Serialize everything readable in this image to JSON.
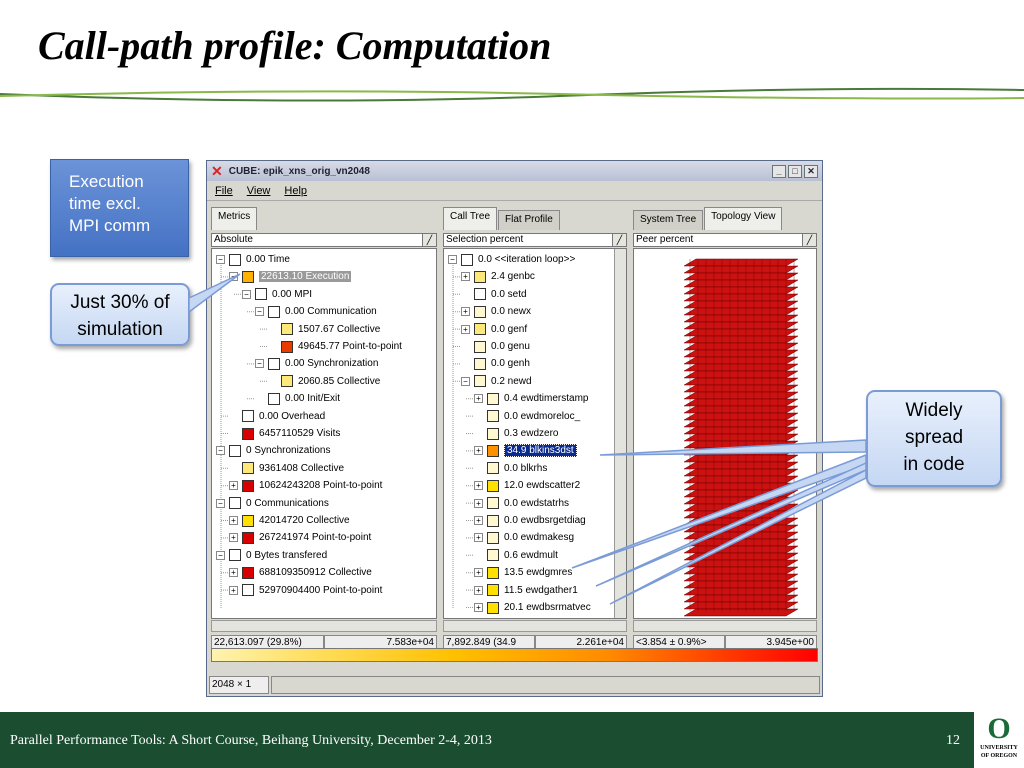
{
  "slide": {
    "title": "Call-path profile: Computation",
    "footer": "Parallel Performance Tools: A Short Course, Beihang University, December 2-4, 2013",
    "page": "12",
    "logo_line1": "UNIVERSITY",
    "logo_line2": "OF OREGON",
    "logo_letter": "O"
  },
  "callouts": {
    "exec": [
      "Execution",
      "time excl.",
      "MPI comm"
    ],
    "just": [
      "Just 30% of",
      "simulation"
    ],
    "widely": [
      "Widely",
      "spread",
      "in code"
    ]
  },
  "window": {
    "title": "CUBE: epik_xns_orig_vn2048",
    "menu": [
      "File",
      "View",
      "Help"
    ],
    "min": "_",
    "max": "□",
    "close": "✕"
  },
  "metrics": {
    "tab": "Metrics",
    "combo": "Absolute",
    "status_left": "22,613.097  (29.8%)",
    "status_right": "7.583e+04",
    "rows": [
      {
        "text": "0.00 Time",
        "color": "#ffffff",
        "exp": "−"
      },
      {
        "text": "22613.10 Execution",
        "color": "#ffb000",
        "exp": "−",
        "sel": true
      },
      {
        "text": "0.00 MPI",
        "color": "#ffffff",
        "exp": "−"
      },
      {
        "text": "0.00 Communication",
        "color": "#ffffff",
        "exp": "−"
      },
      {
        "text": "1507.67 Collective",
        "color": "#ffe87a",
        "exp": ""
      },
      {
        "text": "49645.77 Point-to-point",
        "color": "#e83c00",
        "exp": ""
      },
      {
        "text": "0.00 Synchronization",
        "color": "#ffffff",
        "exp": "−"
      },
      {
        "text": "2060.85 Collective",
        "color": "#ffe87a",
        "exp": ""
      },
      {
        "text": "0.00 Init/Exit",
        "color": "#ffffff",
        "exp": ""
      },
      {
        "text": "0.00 Overhead",
        "color": "#ffffff",
        "exp": ""
      },
      {
        "text": "6457110529 Visits",
        "color": "#d80000",
        "exp": ""
      },
      {
        "text": "0 Synchronizations",
        "color": "#ffffff",
        "exp": "−"
      },
      {
        "text": "9361408 Collective",
        "color": "#ffe87a",
        "exp": ""
      },
      {
        "text": "10624243208 Point-to-point",
        "color": "#d80000",
        "exp": "+"
      },
      {
        "text": "0 Communications",
        "color": "#ffffff",
        "exp": "−"
      },
      {
        "text": "42014720 Collective",
        "color": "#ffe000",
        "exp": "+"
      },
      {
        "text": "267241974 Point-to-point",
        "color": "#d80000",
        "exp": "+"
      },
      {
        "text": "0 Bytes transfered",
        "color": "#ffffff",
        "exp": "−"
      },
      {
        "text": "688109350912 Collective",
        "color": "#d80000",
        "exp": "+"
      },
      {
        "text": "52970904400 Point-to-point",
        "color": "#ffffff",
        "exp": "+"
      }
    ]
  },
  "calltree": {
    "tab_active": "Call Tree",
    "tab_other": "Flat Profile",
    "combo": "Selection percent",
    "status_left": "7,892.849  (34.9",
    "status_right": "2.261e+04",
    "rows": [
      {
        "text": "0.0 <<iteration loop>>",
        "color": "#ffffff",
        "exp": "−"
      },
      {
        "text": "2.4 genbc",
        "color": "#ffe87a",
        "exp": "+"
      },
      {
        "text": "0.0 setd",
        "color": "#ffffff",
        "exp": ""
      },
      {
        "text": "0.0 newx",
        "color": "#fff8d0",
        "exp": "+"
      },
      {
        "text": "0.0 genf",
        "color": "#ffe87a",
        "exp": "+"
      },
      {
        "text": "0.0 genu",
        "color": "#fff8d0",
        "exp": ""
      },
      {
        "text": "0.0 genh",
        "color": "#fff8d0",
        "exp": ""
      },
      {
        "text": "0.2 newd",
        "color": "#fff8d0",
        "exp": "−"
      },
      {
        "text": "0.4 ewdtimerstamp",
        "color": "#fff8d0",
        "exp": "+"
      },
      {
        "text": "0.0 ewdmoreloc_",
        "color": "#fff8d0",
        "exp": ""
      },
      {
        "text": "0.3 ewdzero",
        "color": "#fff8d0",
        "exp": ""
      },
      {
        "text": "34.9 blkins3dst",
        "color": "#ff9000",
        "exp": "+",
        "sel": true
      },
      {
        "text": "0.0 blkrhs",
        "color": "#fff8d0",
        "exp": ""
      },
      {
        "text": "12.0 ewdscatter2",
        "color": "#ffe000",
        "exp": "+"
      },
      {
        "text": "0.0 ewdstatrhs",
        "color": "#fff8d0",
        "exp": "+"
      },
      {
        "text": "0.0 ewdbsrgetdiag",
        "color": "#fff8d0",
        "exp": "+"
      },
      {
        "text": "0.0 ewdmakesg",
        "color": "#fff8d0",
        "exp": "+"
      },
      {
        "text": "0.6 ewdmult",
        "color": "#fff8d0",
        "exp": ""
      },
      {
        "text": "13.5 ewdgmres",
        "color": "#ffe000",
        "exp": "+"
      },
      {
        "text": "11.5 ewdgather1",
        "color": "#ffe000",
        "exp": "+"
      },
      {
        "text": "20.1 ewdbsrmatvec",
        "color": "#ffe000",
        "exp": "+"
      }
    ]
  },
  "system": {
    "tab_other": "System Tree",
    "tab_active": "Topology View",
    "combo": "Peer percent",
    "status_left": "<3.854 ± 0.9%>",
    "status_right": "3.945e+00"
  },
  "bottom": {
    "dims": "2048 × 1"
  },
  "colors": {
    "footer": "#1b4d30",
    "callout": "#4472c4",
    "topology": "#cc1111"
  }
}
